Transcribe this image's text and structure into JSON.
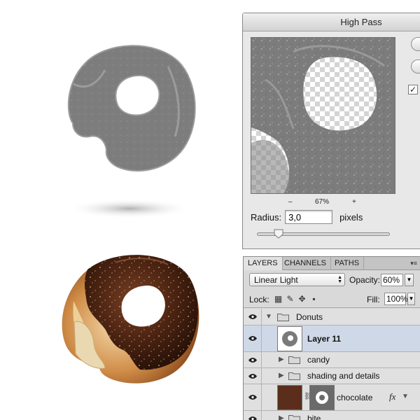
{
  "dialog": {
    "title": "High Pass",
    "zoom_out": "–",
    "zoom_level": "67%",
    "zoom_in": "+",
    "radius_label": "Radius:",
    "radius_value": "3,0",
    "radius_unit": "pixels",
    "preview_checked": true
  },
  "layers_panel": {
    "tabs": [
      "LAYERS",
      "CHANNELS",
      "PATHS"
    ],
    "active_tab": "LAYERS",
    "menu_icon": "panel-menu-icon",
    "blend_mode": "Linear Light",
    "opacity_label": "Opacity:",
    "opacity_value": "60%",
    "lock_label": "Lock:",
    "fill_label": "Fill:",
    "fill_value": "100%",
    "rows": [
      {
        "name": "Donuts",
        "kind": "group",
        "expanded": true
      },
      {
        "name": "Layer 11",
        "kind": "layer",
        "selected": true
      },
      {
        "name": "candy",
        "kind": "group",
        "expanded": false
      },
      {
        "name": "shading and details",
        "kind": "group",
        "expanded": false
      },
      {
        "name": "chocolate",
        "kind": "layer-with-mask",
        "fx": "fx"
      },
      {
        "name": "bite",
        "kind": "group",
        "expanded": false
      }
    ]
  },
  "colors": {
    "selection": "#cfd8e6",
    "chocolate": "#5a2e1a",
    "dough": "#c98b4e"
  }
}
